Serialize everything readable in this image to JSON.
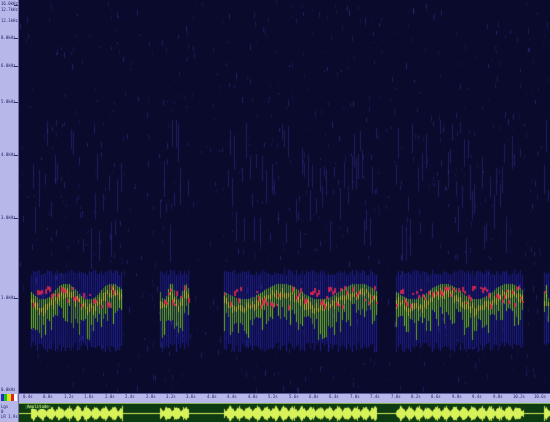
{
  "freq_ruler": {
    "labels": [
      "16.0kHz",
      "12.7kHz",
      "12.1kHz",
      "8.0kHz",
      "6.0kHz",
      "5.0kHz",
      "4.0kHz",
      "3.0kHz",
      "1.0kHz",
      "0.0kHz"
    ]
  },
  "time_ruler": {
    "labels": [
      "0.4s",
      "0.8s",
      "1.2s",
      "1.6s",
      "2.0s",
      "2.4s",
      "2.8s",
      "3.2s",
      "3.6s",
      "4.0s",
      "4.4s",
      "4.8s",
      "5.2s",
      "5.6s",
      "6.0s",
      "6.4s",
      "7.0s",
      "7.4s",
      "7.8s",
      "8.2s",
      "8.6s",
      "9.0s",
      "9.4s",
      "9.8s",
      "10.2s",
      "10.6s"
    ]
  },
  "status": {
    "line1": "Lgs",
    "line2": "0",
    "line3": "LR 1.9s",
    "palette_icon": "color-palette-icon",
    "palette_colors": [
      "#2030c0",
      "#20c020",
      "#e0e020",
      "#e02020",
      "#ffffff"
    ]
  },
  "waveform_panel": {
    "label": "Amplitude"
  },
  "colors": {
    "background": "#0a0a2a",
    "ruler": "#b7b7ea",
    "wave_bg": "#0f3b12",
    "wave": "#d8f25a"
  }
}
